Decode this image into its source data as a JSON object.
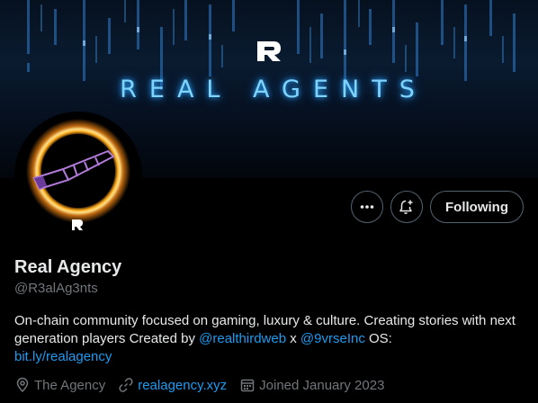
{
  "banner": {
    "title": "REAL AGENTS",
    "logo_letter": "R"
  },
  "profile": {
    "display_name": "Real Agency",
    "handle": "@R3alAg3nts",
    "avatar_logo": "R"
  },
  "actions": {
    "more": "more-icon",
    "notify": "bell-plus-icon",
    "follow_label": "Following"
  },
  "bio": {
    "text1": "On-chain community focused on gaming, luxury & culture. Creating stories with next generation players Created by ",
    "mention1": "@realthirdweb",
    "text2": " x ",
    "mention2": "@9vrseInc",
    "text3": " OS: ",
    "link": "bit.ly/realagency"
  },
  "meta": {
    "location": "The Agency",
    "website": "realagency.xyz",
    "joined": "Joined January 2023"
  },
  "colors": {
    "accent": "#1d9bf0",
    "muted": "#71767b",
    "glow": "#7fd4ff"
  }
}
